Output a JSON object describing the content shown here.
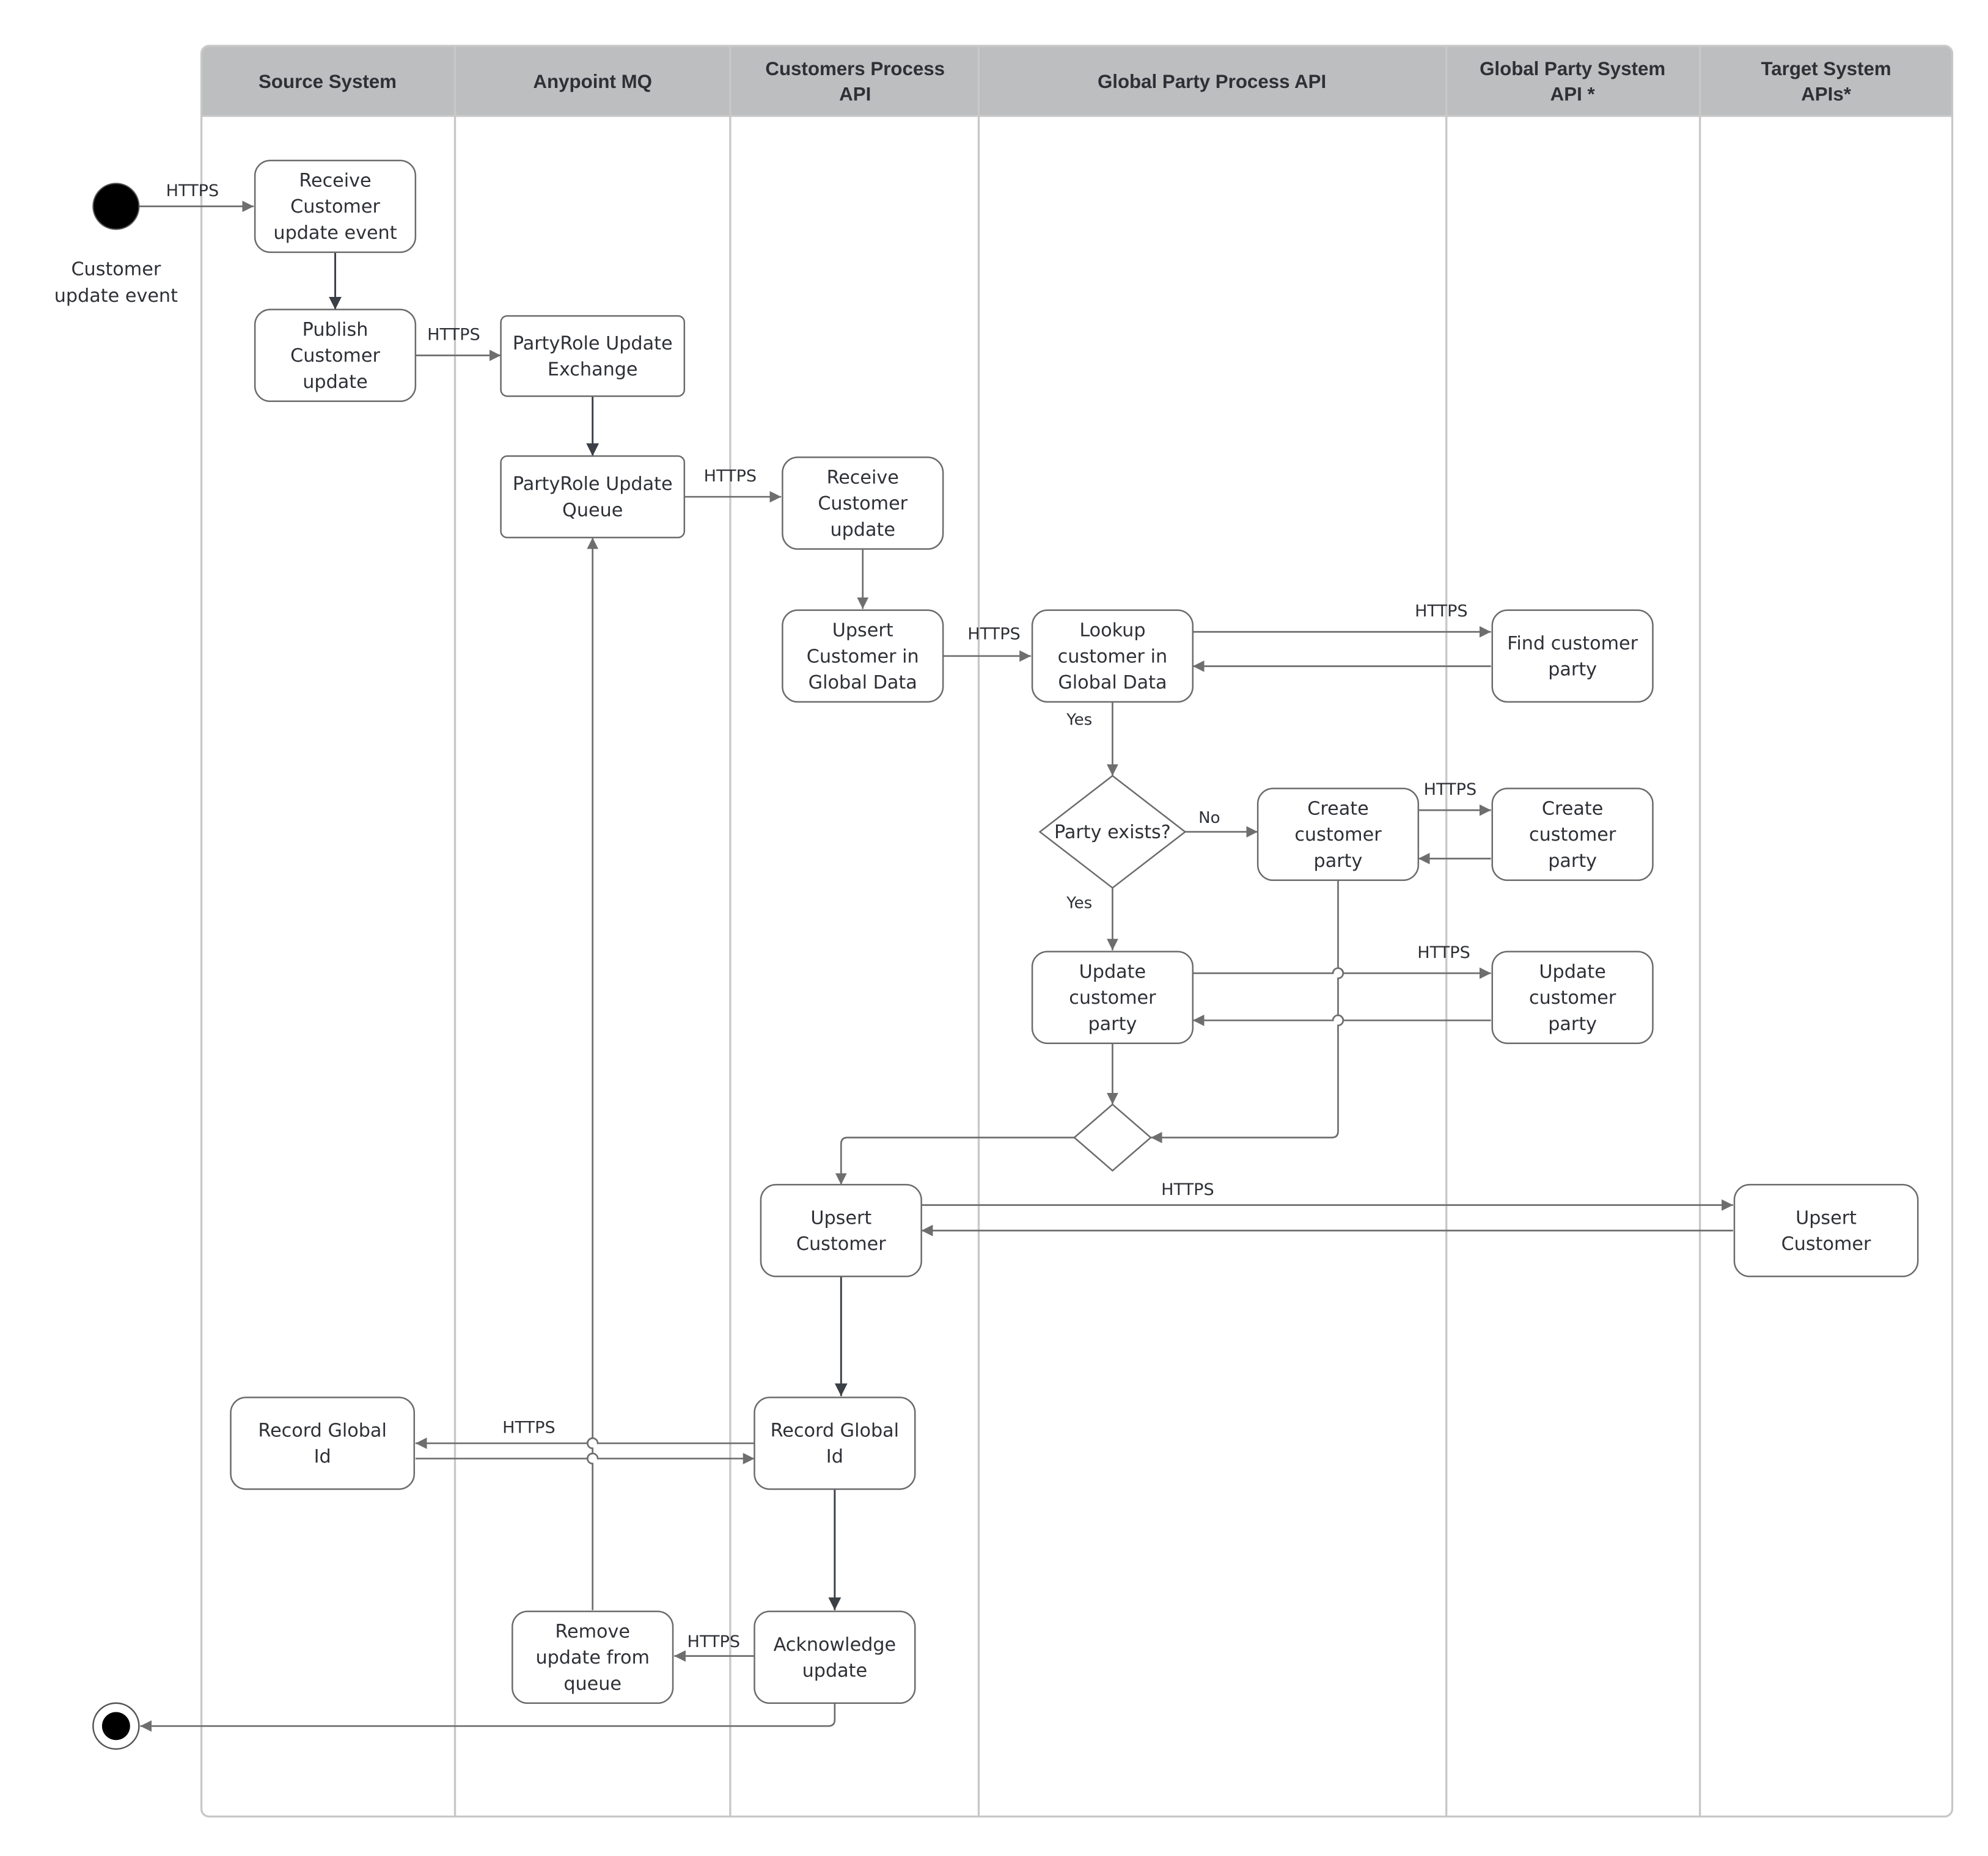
{
  "lanes": [
    {
      "id": "source",
      "label": [
        "Source System"
      ]
    },
    {
      "id": "mq",
      "label": [
        "Anypoint MQ"
      ]
    },
    {
      "id": "cpapi",
      "label": [
        "Customers Process",
        "API"
      ]
    },
    {
      "id": "gppapi",
      "label": [
        "Global Party Process API"
      ]
    },
    {
      "id": "gpsapi",
      "label": [
        "Global Party System",
        "API *"
      ]
    },
    {
      "id": "tsapi",
      "label": [
        "Target System",
        "APIs*"
      ]
    }
  ],
  "start": {
    "label": [
      "Customer",
      "update event"
    ]
  },
  "nodes": [
    {
      "id": "receive-event",
      "lines": [
        "Receive",
        "Customer",
        "update event"
      ]
    },
    {
      "id": "publish-update",
      "lines": [
        "Publish",
        "Customer",
        "update"
      ]
    },
    {
      "id": "exchange",
      "lines": [
        "PartyRole Update",
        "Exchange"
      ]
    },
    {
      "id": "queue",
      "lines": [
        "PartyRole Update",
        "Queue"
      ]
    },
    {
      "id": "receive-update",
      "lines": [
        "Receive",
        "Customer",
        "update"
      ]
    },
    {
      "id": "upsert-global",
      "lines": [
        "Upsert",
        "Customer in",
        "Global Data"
      ]
    },
    {
      "id": "lookup",
      "lines": [
        "Lookup",
        "customer in",
        "Global Data"
      ]
    },
    {
      "id": "find-party",
      "lines": [
        "Find customer",
        "party"
      ]
    },
    {
      "id": "create-party-p",
      "lines": [
        "Create",
        "customer",
        "party"
      ]
    },
    {
      "id": "create-party-s",
      "lines": [
        "Create",
        "customer",
        "party"
      ]
    },
    {
      "id": "update-party-p",
      "lines": [
        "Update",
        "customer",
        "party"
      ]
    },
    {
      "id": "update-party-s",
      "lines": [
        "Update",
        "customer",
        "party"
      ]
    },
    {
      "id": "upsert-customer-p",
      "lines": [
        "Upsert",
        "Customer"
      ]
    },
    {
      "id": "upsert-customer-t",
      "lines": [
        "Upsert",
        "Customer"
      ]
    },
    {
      "id": "record-id-s",
      "lines": [
        "Record Global",
        "Id"
      ]
    },
    {
      "id": "record-id-p",
      "lines": [
        "Record Global",
        "Id"
      ]
    },
    {
      "id": "remove-update",
      "lines": [
        "Remove",
        "update from",
        "queue"
      ]
    },
    {
      "id": "ack-update",
      "lines": [
        "Acknowledge",
        "update"
      ]
    }
  ],
  "decision": {
    "label": "Party exists?"
  },
  "edge_labels": {
    "https": "HTTPS",
    "yes": "Yes",
    "no": "No"
  }
}
